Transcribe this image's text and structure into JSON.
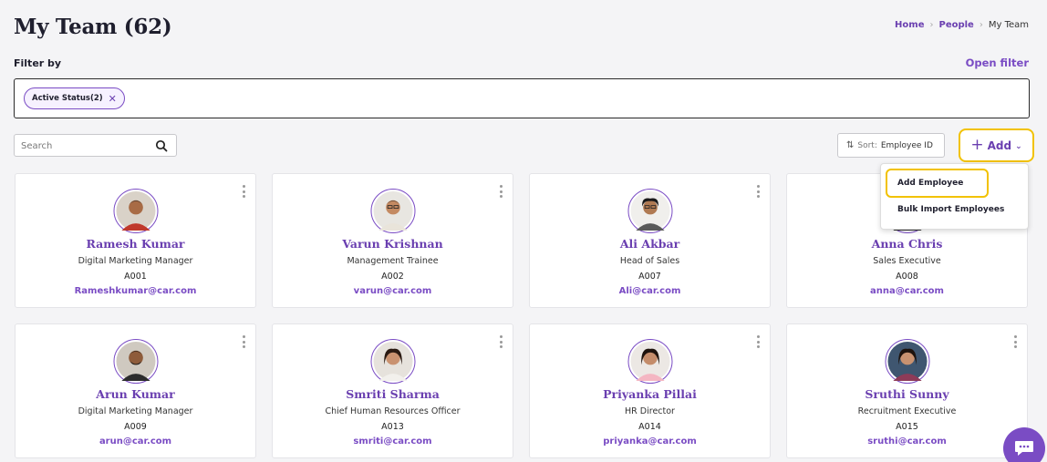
{
  "header": {
    "title": "My Team (62)",
    "breadcrumb": [
      "Home",
      "People",
      "My Team"
    ]
  },
  "filter": {
    "label": "Filter by",
    "open_filter": "Open filter",
    "chips": [
      {
        "label": "Active Status(2)"
      }
    ]
  },
  "toolbar": {
    "search_placeholder": "Search",
    "sort_prefix": "Sort:",
    "sort_value": "Employee ID",
    "add_label": "Add"
  },
  "add_menu": {
    "items": [
      "Add Employee",
      "Bulk Import Employees"
    ]
  },
  "employees": [
    {
      "name": "Ramesh Kumar",
      "role": "Digital Marketing Manager",
      "id": "A001",
      "email": "Rameshkumar@car.com"
    },
    {
      "name": "Varun Krishnan",
      "role": "Management Trainee",
      "id": "A002",
      "email": "varun@car.com"
    },
    {
      "name": "Ali Akbar",
      "role": "Head of Sales",
      "id": "A007",
      "email": "Ali@car.com"
    },
    {
      "name": "Anna Chris",
      "role": "Sales Executive",
      "id": "A008",
      "email": "anna@car.com"
    },
    {
      "name": "Arun Kumar",
      "role": "Digital Marketing Manager",
      "id": "A009",
      "email": "arun@car.com"
    },
    {
      "name": "Smriti Sharma",
      "role": "Chief Human Resources Officer",
      "id": "A013",
      "email": "smriti@car.com"
    },
    {
      "name": "Priyanka Pillai",
      "role": "HR Director",
      "id": "A014",
      "email": "priyanka@car.com"
    },
    {
      "name": "Sruthi Sunny",
      "role": "Recruitment Executive",
      "id": "A015",
      "email": "sruthi@car.com"
    }
  ],
  "colors": {
    "accent": "#7a4cc4",
    "highlight": "#f2c200"
  }
}
